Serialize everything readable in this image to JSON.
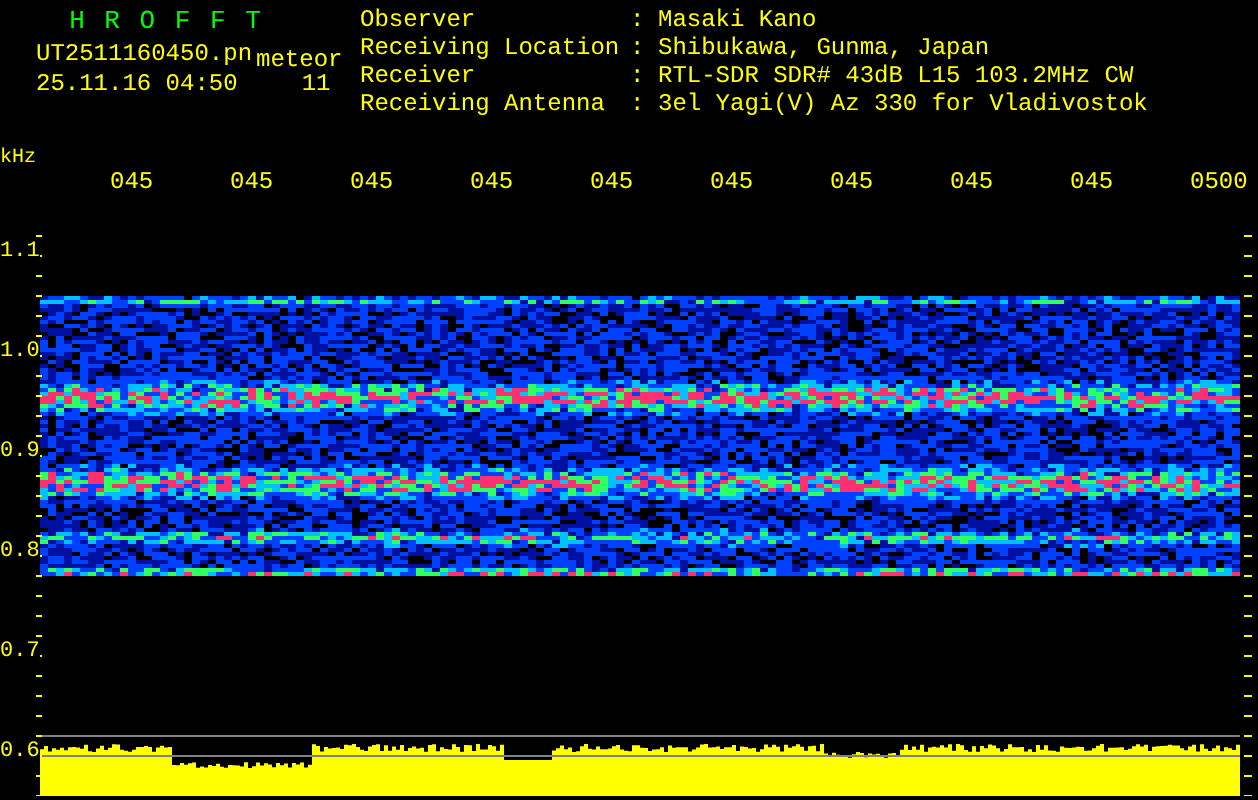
{
  "app": {
    "title": "H R O F F T",
    "file": "UT2511160450.pn",
    "mode": "meteor",
    "datetime": "25.11.16 04:50",
    "count": "11"
  },
  "info": [
    {
      "label": "Observer",
      "separator": ":",
      "value": "Masaki Kano"
    },
    {
      "label": "Receiving Location",
      "separator": ":",
      "value": "Shibukawa, Gunma, Japan"
    },
    {
      "label": "Receiver",
      "separator": ":",
      "value": "RTL-SDR SDR# 43dB L15 103.2MHz CW"
    },
    {
      "label": "Receiving Antenna",
      "separator": ":",
      "value": "3el Yagi(V) Az 330 for Vladivostok"
    }
  ],
  "freq_axis": {
    "unit": "kHz",
    "labels": [
      "1.1",
      "1.0",
      "0.9",
      "0.8",
      "0.7",
      "0.6"
    ]
  },
  "time_labels": [
    "045",
    "045",
    "045",
    "045",
    "045",
    "045",
    "045",
    "045",
    "045",
    "0500"
  ]
}
